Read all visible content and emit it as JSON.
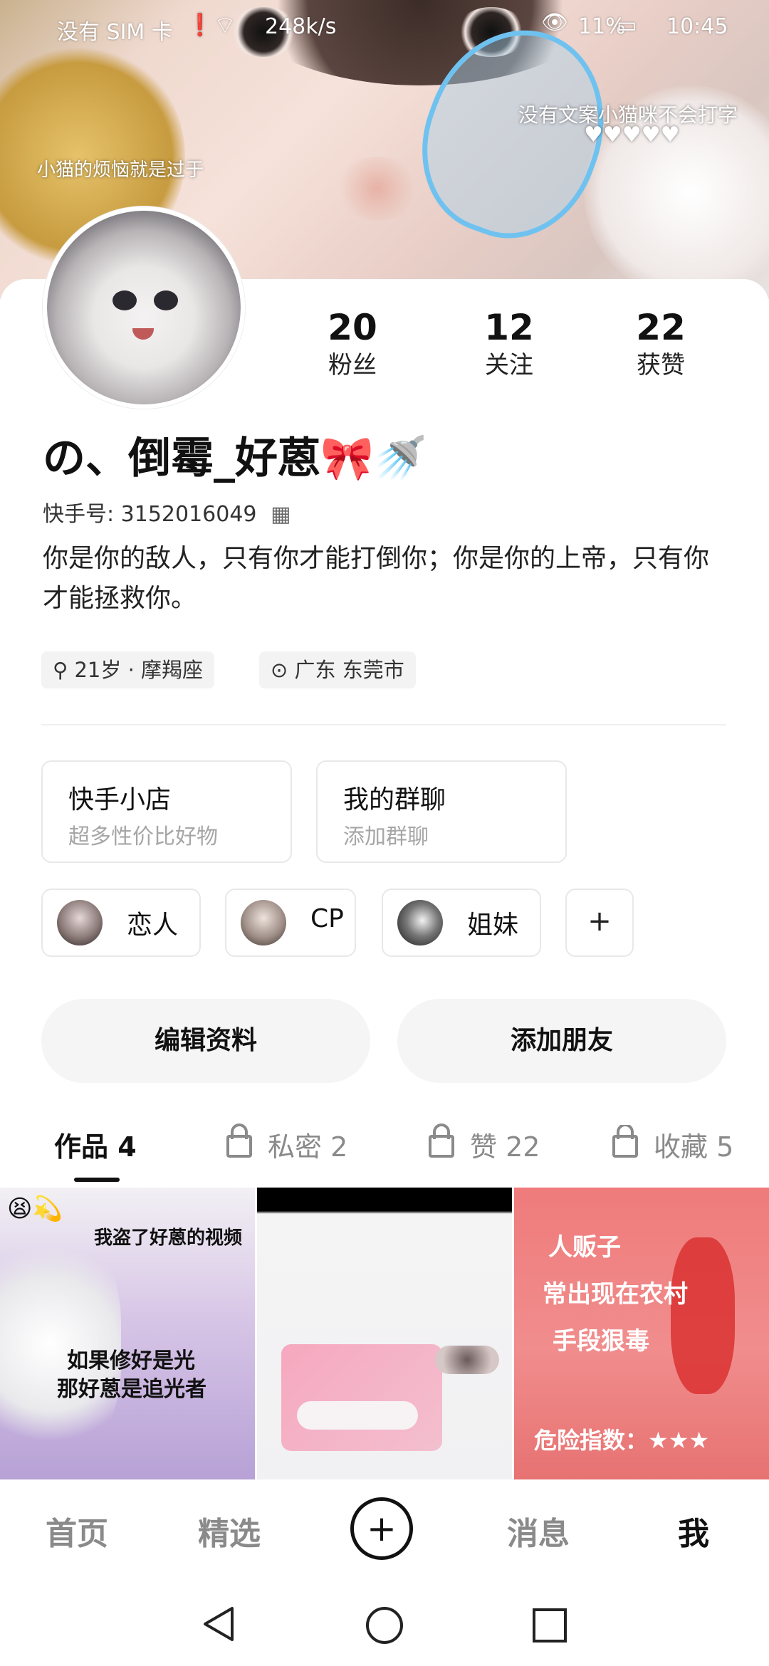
{
  "status_bar": {
    "carrier": "没有 SIM 卡",
    "speed": "248k/s",
    "battery": "11%",
    "time": "10:45"
  },
  "banner": {
    "caption_left": "小猫的烦恼就是过于",
    "caption_right_1": "没有文案小猫咪不会打字",
    "caption_right_2": "♥♥♥♥♥"
  },
  "profile": {
    "name": "の、倒霉_好蒽🎀🚿",
    "kuaishou_id": "快手号: 3152016049",
    "bio": "你是你的敌人，只有你才能打倒你；你是你的上帝，只有你才能拯救你。",
    "tag_age": "21岁 · 摩羯座",
    "tag_location": "广东 东莞市"
  },
  "stats": [
    {
      "value": "20",
      "label": "粉丝"
    },
    {
      "value": "12",
      "label": "关注"
    },
    {
      "value": "22",
      "label": "获赞"
    }
  ],
  "features": [
    {
      "title": "快手小店",
      "subtitle": "超多性价比好物"
    },
    {
      "title": "我的群聊",
      "subtitle": "添加群聊"
    }
  ],
  "relations": [
    {
      "label": "恋人"
    },
    {
      "label": "CP"
    },
    {
      "label": "姐妹"
    },
    {
      "label": "+"
    }
  ],
  "buttons": {
    "edit": "编辑资料",
    "add_friend": "添加朋友"
  },
  "tabs": [
    {
      "label": "作品 4"
    },
    {
      "label": "私密 2"
    },
    {
      "label": "赞 22"
    },
    {
      "label": "收藏 5"
    }
  ],
  "thumbs": {
    "t1_top": "我盗了好蒽的视频",
    "t1_mid_1": "如果修好是光",
    "t1_mid_2": "那好蒽是追光者",
    "t3_1": "人贩子",
    "t3_2": "常出现在农村",
    "t3_3": "手段狠毒",
    "t3_4": "危险指数：★★★"
  },
  "bottom_nav": {
    "home": "首页",
    "featured": "精选",
    "create": "+",
    "messages": "消息",
    "me": "我"
  },
  "colors": {
    "accent_dark": "#111111",
    "muted": "#8a8a8a",
    "chip_border": "#e8e8e8"
  }
}
